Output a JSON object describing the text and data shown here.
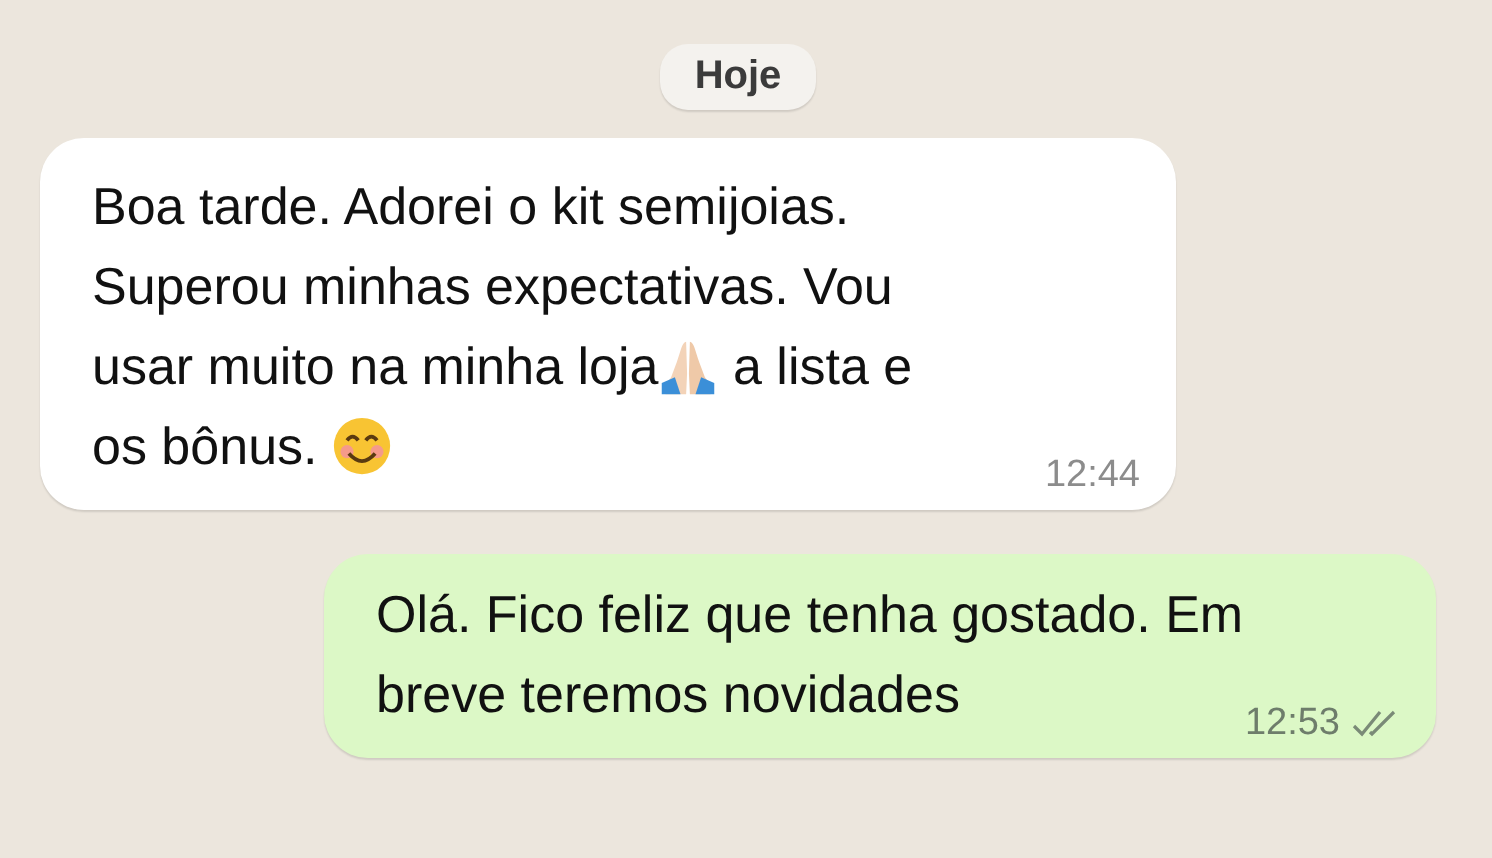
{
  "date_chip": "Hoje",
  "messages": [
    {
      "kind": "incoming",
      "time": "12:44",
      "lines": [
        [
          {
            "kind": "text",
            "text": "Boa tarde. Adorei o kit semijoias."
          }
        ],
        [
          {
            "kind": "text",
            "text": "Superou minhas expectativas. Vou"
          }
        ],
        [
          {
            "kind": "text",
            "text": "usar muito na minha loja"
          },
          {
            "kind": "praying-hands"
          },
          {
            "kind": "text",
            "text": " a lista e"
          }
        ],
        [
          {
            "kind": "text",
            "text": "os bônus. "
          },
          {
            "kind": "smile"
          }
        ]
      ]
    },
    {
      "kind": "outgoing",
      "time": "12:53",
      "read": false,
      "lines": [
        [
          {
            "kind": "text",
            "text": "Olá. Fico feliz que tenha gostado. Em"
          }
        ],
        [
          {
            "kind": "text",
            "text": "breve teremos novidades"
          }
        ]
      ]
    }
  ]
}
